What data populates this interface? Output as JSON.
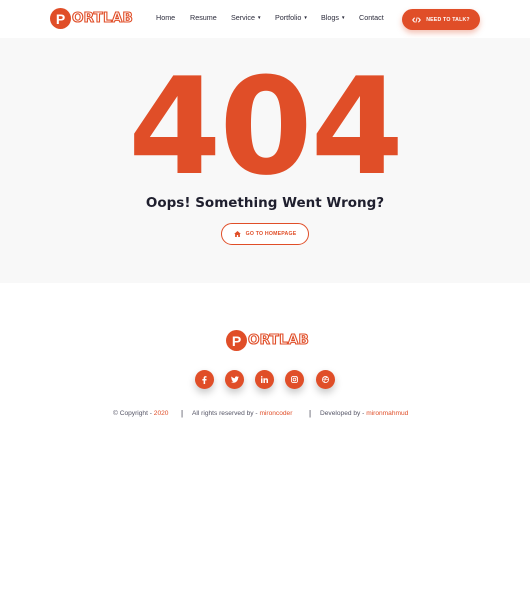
{
  "brand": {
    "badge_letter": "P",
    "name": "ORTLAB",
    "accent_color": "#e04e28"
  },
  "nav": {
    "items": [
      {
        "label": "Home",
        "has_dropdown": false
      },
      {
        "label": "Resume",
        "has_dropdown": false
      },
      {
        "label": "Service",
        "has_dropdown": true
      },
      {
        "label": "Portfolio",
        "has_dropdown": true
      },
      {
        "label": "Blogs",
        "has_dropdown": true
      },
      {
        "label": "Contact",
        "has_dropdown": false
      }
    ],
    "cta_label": "NEED TO TALK?",
    "cta_icon": "code-icon"
  },
  "error": {
    "code": "404",
    "message": "Oops! Something Went Wrong?",
    "home_button_label": "GO TO HOMEPAGE",
    "home_button_icon": "home-icon"
  },
  "footer": {
    "socials": [
      {
        "icon": "facebook-icon",
        "glyph": "f"
      },
      {
        "icon": "twitter-icon",
        "glyph": "t"
      },
      {
        "icon": "linkedin-icon",
        "glyph": "in"
      },
      {
        "icon": "instagram-icon",
        "glyph": "ig"
      },
      {
        "icon": "dribbble-icon",
        "glyph": "dr"
      }
    ],
    "copyright_prefix": "© Copyright - ",
    "year": "2020",
    "rights_prefix": "All rights reserved by - ",
    "rights_owner": "mironcoder",
    "developed_prefix": "Developed by - ",
    "developer": "mironmahmud",
    "separator": "|"
  }
}
